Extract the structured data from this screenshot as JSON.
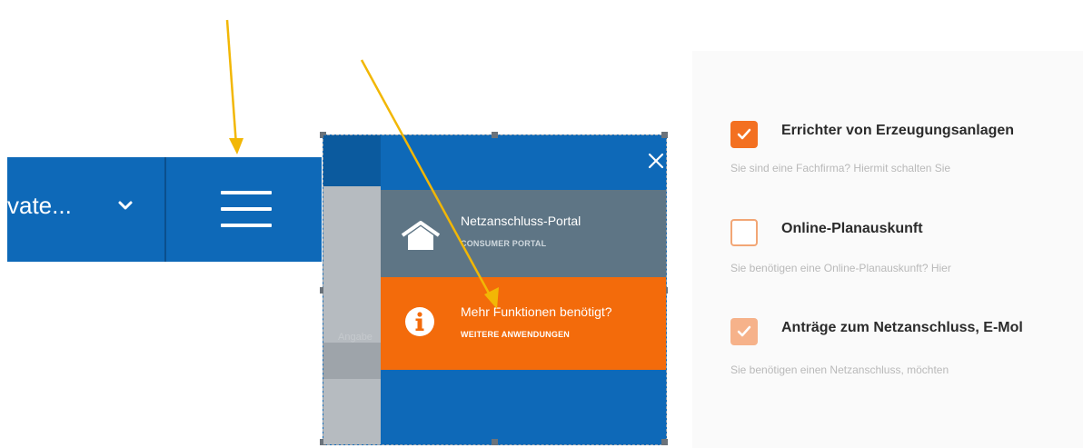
{
  "header": {
    "user_select_label": "vate...",
    "chevron_icon": "chevron-down-icon",
    "menu_icon": "hamburger-menu-icon",
    "bar_color": "#0e69b8"
  },
  "mobile_menu": {
    "close_icon": "close-icon",
    "faded_label": "Angabe",
    "items": [
      {
        "icon": "home-icon",
        "title": "Netzanschluss-Portal",
        "subtitle": "CONSUMER PORTAL",
        "bg_color": "#5e7585"
      },
      {
        "icon": "info-icon",
        "title": "Mehr Funktionen benötigt?",
        "subtitle": "WEITERE ANWENDUNGEN",
        "bg_color": "#f36b0b"
      }
    ]
  },
  "options": [
    {
      "title": "Errichter von Erzeugungsanlagen",
      "description": "Sie sind eine Fachfirma? Hiermit schalten Sie",
      "state": "checked"
    },
    {
      "title": "Online-Planauskunft",
      "description": "Sie benötigen eine Online-Planauskunft? Hier",
      "state": "unchecked"
    },
    {
      "title": "Anträge zum Netzanschluss, E-Mol",
      "description": "Sie benötigen einen Netzanschluss, möchten",
      "state": "checked-disabled"
    }
  ],
  "colors": {
    "accent_orange": "#f37021",
    "brand_blue": "#0e69b8",
    "annotation_arrow": "#f2b705"
  }
}
